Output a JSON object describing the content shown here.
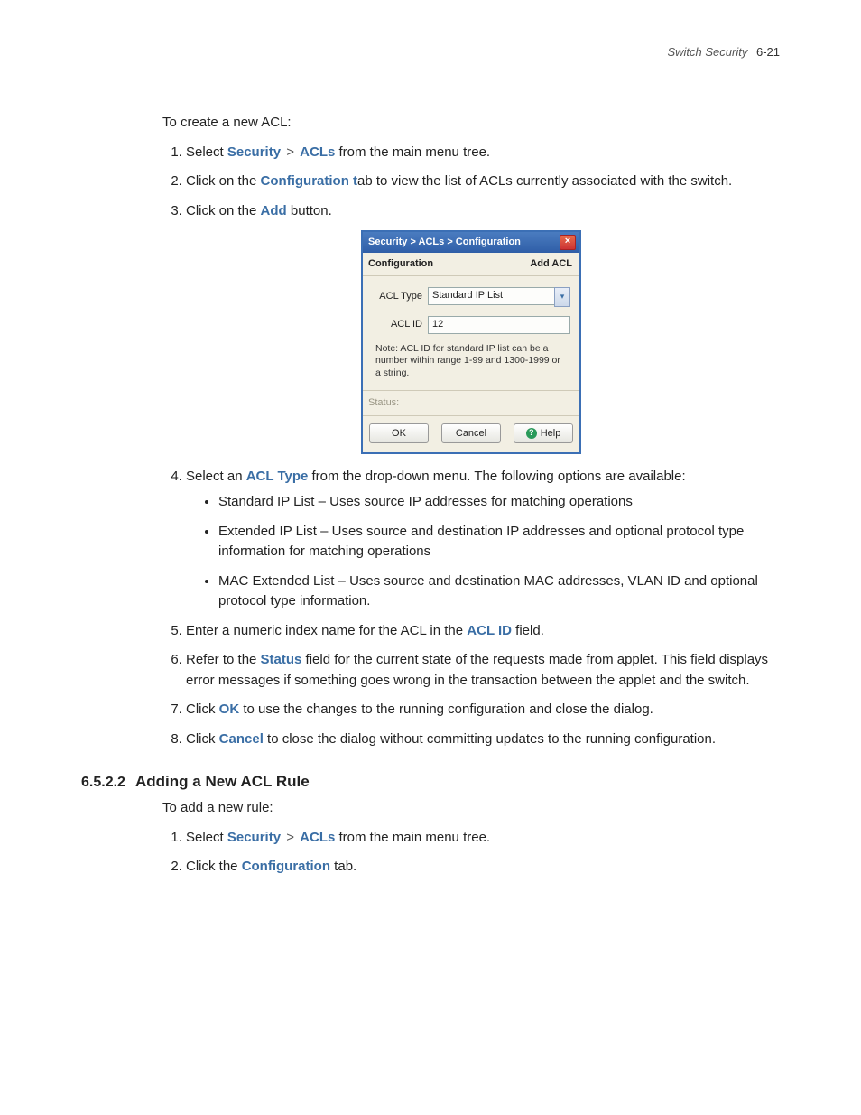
{
  "header": {
    "title": "Switch Security",
    "page": "6-21"
  },
  "section1": {
    "intro": "To create a new ACL:",
    "steps_a": [
      {
        "pre": "Select ",
        "b1": "Security",
        "mid": " > ",
        "b2": "ACLs",
        "post": " from the main menu tree."
      },
      {
        "pre": "Click on the ",
        "b1": "Configuration t",
        "post": "ab to view the list of ACLs currently associated with the switch."
      },
      {
        "pre": "Click on the ",
        "b1": "Add",
        "post": " button."
      }
    ],
    "steps_b": [
      {
        "pre": "Select an ",
        "b1": "ACL Type",
        "post": " from the drop-down menu. The following options are available:",
        "bullets": [
          "Standard IP List – Uses source IP addresses for matching operations",
          "Extended IP List – Uses source and destination IP addresses and optional protocol type information for matching operations",
          "MAC Extended List – Uses source and destination MAC addresses, VLAN ID and optional protocol type information."
        ]
      },
      {
        "pre": "Enter a numeric index name for the ACL in the ",
        "b1": "ACL ID",
        "post": " field."
      },
      {
        "pre": "Refer to the ",
        "b1": "Status",
        "post": " field for the current state of the requests made from applet. This field displays error messages if something goes wrong in the transaction between the applet and the switch."
      },
      {
        "pre": "Click ",
        "b1": "OK",
        "post": " to use the changes to the running configuration and close the dialog."
      },
      {
        "pre": "Click ",
        "b1": "Cancel",
        "post": " to close the dialog without committing updates to the running configuration."
      }
    ]
  },
  "dialog": {
    "title": "Security > ACLs > Configuration",
    "sub_left": "Configuration",
    "sub_right": "Add ACL",
    "acl_type_label": "ACL Type",
    "acl_type_value": "Standard IP List",
    "acl_id_label": "ACL ID",
    "acl_id_value": "12",
    "note": "Note: ACL ID for standard IP list can be a number within range 1-99 and 1300-1999 or a string.",
    "status_label": "Status:",
    "ok": "OK",
    "cancel": "Cancel",
    "help": "Help"
  },
  "section2": {
    "num": "6.5.2.2",
    "title": "Adding a New ACL Rule",
    "intro": "To add a new rule:",
    "steps": [
      {
        "pre": "Select ",
        "b1": "Security",
        "mid": " > ",
        "b2": "ACLs",
        "post": " from the main menu tree."
      },
      {
        "pre": "Click the ",
        "b1": "Configuration",
        "post": " tab."
      }
    ]
  }
}
